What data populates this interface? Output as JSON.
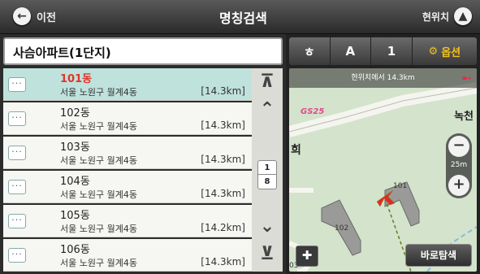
{
  "topbar": {
    "back_label": "이전",
    "title": "명칭검색",
    "location_label": "현위치"
  },
  "search": {
    "query": "사슴아파트(1단지)"
  },
  "results": [
    {
      "name": "101동",
      "address": "서울 노원구 월계4동",
      "distance": "[14.3km]",
      "selected": true
    },
    {
      "name": "102동",
      "address": "서울 노원구 월계4동",
      "distance": "[14.3km]",
      "selected": false
    },
    {
      "name": "103동",
      "address": "서울 노원구 월계4동",
      "distance": "[14.3km]",
      "selected": false
    },
    {
      "name": "104동",
      "address": "서울 노원구 월계4동",
      "distance": "[14.3km]",
      "selected": false
    },
    {
      "name": "105동",
      "address": "서울 노원구 월계4동",
      "distance": "[14.2km]",
      "selected": false
    },
    {
      "name": "106동",
      "address": "서울 노원구 월계4동",
      "distance": "[14.3km]",
      "selected": false
    }
  ],
  "pager": {
    "current": "1",
    "total": "8"
  },
  "tabs": [
    {
      "label": "ㅎ"
    },
    {
      "label": "A"
    },
    {
      "label": "1"
    },
    {
      "label": "옵션"
    }
  ],
  "map": {
    "distance_info": "현위치에서 14.3km",
    "label_nok": "녹천",
    "label_hee": "희",
    "label_gs": "GS25",
    "building_101": "101",
    "building_102": "102",
    "label_03": "03",
    "zoom_scale": "25m",
    "navigate_label": "바로탐색"
  },
  "colors": {
    "selected_row": "#bfe2dc",
    "selected_text": "#e0352a",
    "option_tab": "#f3c21b"
  }
}
